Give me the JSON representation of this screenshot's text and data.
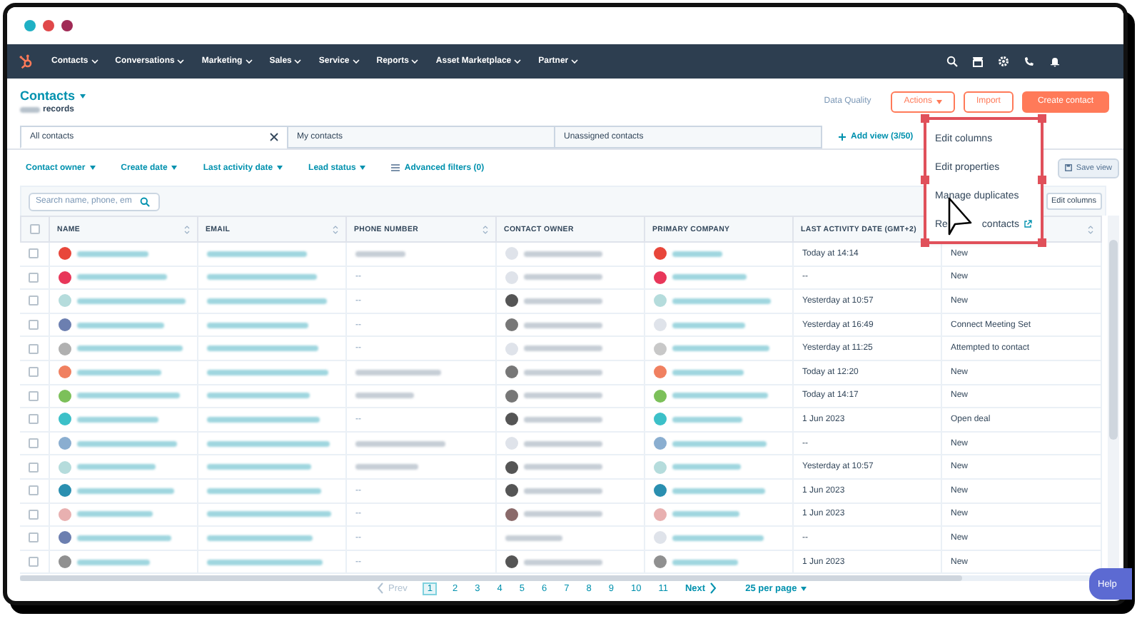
{
  "nav": {
    "items": [
      "Contacts",
      "Conversations",
      "Marketing",
      "Sales",
      "Service",
      "Reports",
      "Asset Marketplace",
      "Partner"
    ]
  },
  "header": {
    "title": "Contacts",
    "records_label": "records",
    "data_quality": "Data Quality",
    "actions": "Actions",
    "import": "Import",
    "create": "Create contact"
  },
  "tabs": [
    {
      "label": "All contacts",
      "selected": true,
      "closable": true
    },
    {
      "label": "My contacts",
      "selected": false,
      "closable": false
    },
    {
      "label": "Unassigned contacts",
      "selected": false,
      "closable": false
    }
  ],
  "add_view": "Add view (3/50)",
  "filters": [
    "Contact owner",
    "Create date",
    "Last activity date",
    "Lead status"
  ],
  "advanced_filters": "Advanced filters (0)",
  "save_view": "Save view",
  "search": {
    "placeholder": "Search name, phone, em"
  },
  "edit_columns": "Edit columns",
  "table": {
    "select_all": {
      "checked": false
    },
    "columns": [
      {
        "label": "NAME",
        "sort_icon": true
      },
      {
        "label": "EMAIL",
        "sort_icon": true
      },
      {
        "label": "PHONE NUMBER",
        "sort_icon": true
      },
      {
        "label": "CONTACT OWNER",
        "sort_icon": false
      },
      {
        "label": "PRIMARY COMPANY",
        "sort_icon": false
      },
      {
        "label": "LAST ACTIVITY DATE (GMT+2)"
      },
      {
        "sort_icon": true
      }
    ],
    "rows": [
      {
        "checked": false,
        "avatar": {
          "color": "#e8463a"
        },
        "company_avatar": {
          "color": "#e8463a"
        },
        "owner_avatar": {
          "color": "#dfe3ea"
        },
        "last_activity": "Today at 14:14",
        "lead_status": "New"
      },
      {
        "checked": false,
        "avatar": {
          "color": "#e8375a"
        },
        "company_avatar": {
          "color": "#e8375a"
        },
        "phone": "--",
        "owner_avatar": {
          "color": "#dfe3ea"
        },
        "last_activity": "--",
        "lead_status": "New"
      },
      {
        "checked": false,
        "avatar": {
          "color": "#b5dcdc"
        },
        "company_avatar": {
          "color": "#b5dcdc"
        },
        "phone": "--",
        "owner_avatar": {
          "color": "#555555"
        },
        "last_activity": "Yesterday at 10:57",
        "lead_status": "New"
      },
      {
        "checked": false,
        "avatar": {
          "color": "#6c7fb0"
        },
        "company_avatar": {
          "color": "#dfe3ea"
        },
        "phone": "--",
        "owner_avatar": {
          "color": "#777777"
        },
        "last_activity": "Yesterday at 16:49",
        "lead_status": "Connect Meeting Set"
      },
      {
        "checked": false,
        "avatar": {
          "color": "#b0b0b0"
        },
        "company_avatar": {
          "color": "#c8c8c8"
        },
        "phone": "--",
        "owner_avatar": {
          "color": "#dfe3ea"
        },
        "last_activity": "Yesterday at 11:25",
        "lead_status": "Attempted to contact"
      },
      {
        "checked": false,
        "avatar": {
          "color": "#f08060"
        },
        "company_avatar": {
          "color": "#f08060"
        },
        "owner_avatar": {
          "color": "#777777"
        },
        "last_activity": "Today at 12:20",
        "lead_status": "New"
      },
      {
        "checked": false,
        "avatar": {
          "color": "#7cc05a"
        },
        "company_avatar": {
          "color": "#7cc05a"
        },
        "owner_avatar": {
          "color": "#777777"
        },
        "last_activity": "Today at 14:17",
        "lead_status": "New"
      },
      {
        "checked": false,
        "avatar": {
          "color": "#3cc0c8"
        },
        "company_avatar": {
          "color": "#3cc0c8"
        },
        "phone": "--",
        "owner_avatar": {
          "color": "#555555"
        },
        "last_activity": "1 Jun 2023",
        "lead_status": "Open deal"
      },
      {
        "checked": false,
        "avatar": {
          "color": "#8aaed0"
        },
        "company_avatar": {
          "color": "#8aaed0"
        },
        "owner_avatar": {
          "color": "#dfe3ea"
        },
        "last_activity": "--",
        "lead_status": "New"
      },
      {
        "checked": false,
        "avatar": {
          "color": "#b5dcdc"
        },
        "company_avatar": {
          "color": "#b5dcdc"
        },
        "owner_avatar": {
          "color": "#555555"
        },
        "last_activity": "Yesterday at 10:57",
        "lead_status": "New"
      },
      {
        "checked": false,
        "avatar": {
          "color": "#2a8fb0"
        },
        "company_avatar": {
          "color": "#2a8fb0"
        },
        "phone": "--",
        "owner_avatar": {
          "color": "#555555"
        },
        "last_activity": "1 Jun 2023",
        "lead_status": "New"
      },
      {
        "checked": false,
        "avatar": {
          "color": "#e8b0b0"
        },
        "company_avatar": {
          "color": "#e8b0b0"
        },
        "phone": "--",
        "owner_avatar": {
          "color": "#8a6a6a"
        },
        "last_activity": "1 Jun 2023",
        "lead_status": "New"
      },
      {
        "checked": false,
        "avatar": {
          "color": "#6c7fb0"
        },
        "company_avatar": {
          "color": "#dfe3ea"
        },
        "phone": "--",
        "last_activity": "--",
        "lead_status": "New"
      },
      {
        "checked": false,
        "avatar": {
          "color": "#909090"
        },
        "company_avatar": {
          "color": "#909090"
        },
        "phone": "--",
        "owner_avatar": {
          "color": "#555555"
        },
        "last_activity": "1 Jun 2023",
        "lead_status": "New"
      }
    ]
  },
  "pager": {
    "prev": {
      "label": "Prev",
      "disabled": true
    },
    "pages": [
      {
        "label": "1",
        "selected": true
      },
      {
        "label": "2",
        "selected": false
      },
      {
        "label": "3",
        "selected": false
      },
      {
        "label": "4",
        "selected": false
      },
      {
        "label": "5",
        "selected": false
      },
      {
        "label": "6",
        "selected": false
      },
      {
        "label": "7",
        "selected": false
      },
      {
        "label": "8",
        "selected": false
      },
      {
        "label": "9",
        "selected": false
      },
      {
        "label": "10",
        "selected": false
      },
      {
        "label": "11",
        "selected": false
      }
    ],
    "next": {
      "label": "Next",
      "disabled": false
    },
    "per_page": "25 per page"
  },
  "menu": {
    "items": [
      {
        "kind": "plain",
        "label": "Edit columns"
      },
      {
        "kind": "plain",
        "label": "Edit properties"
      },
      {
        "kind": "plain",
        "label": "Manage duplicates"
      },
      {
        "kind": "covered",
        "label_start": "Re",
        "label_end": "contacts"
      }
    ]
  },
  "help": "Help"
}
